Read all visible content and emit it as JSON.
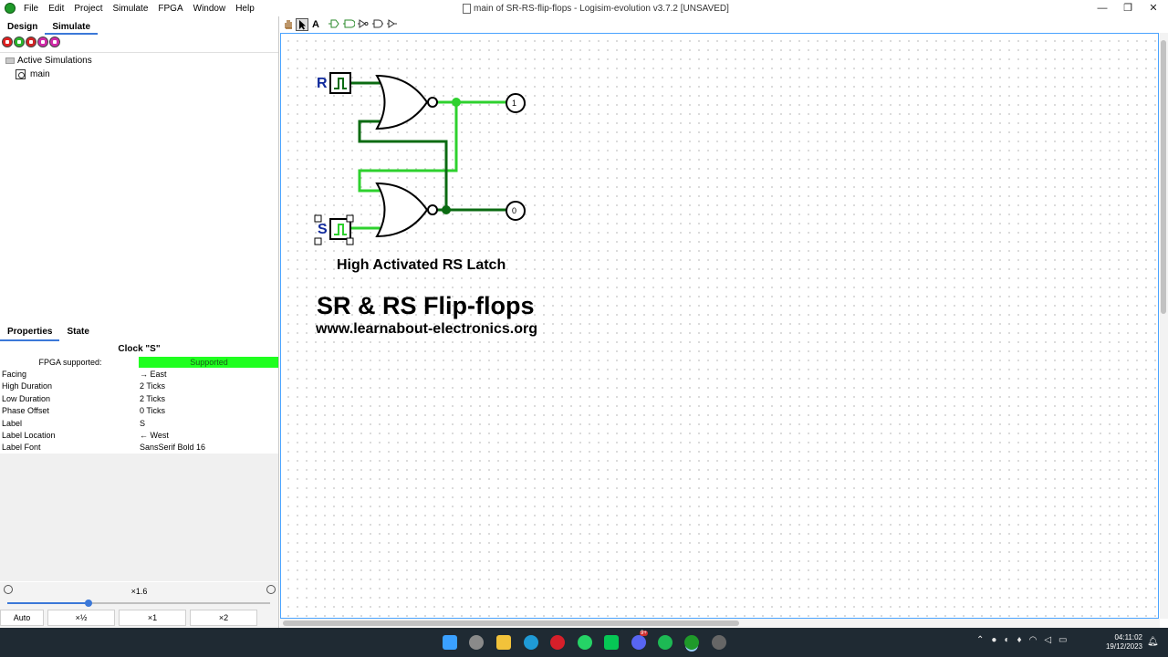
{
  "window": {
    "title": "main of SR-RS-flip-flops - Logisim-evolution v3.7.2 [UNSAVED]",
    "controls": [
      "—",
      "❐",
      "✕"
    ]
  },
  "menu": [
    "File",
    "Edit",
    "Project",
    "Simulate",
    "FPGA",
    "Window",
    "Help"
  ],
  "left_panel": {
    "tabs": [
      "Design",
      "Simulate"
    ],
    "active_tab": "Simulate",
    "sim_toolbar_icons": [
      "stop-icon",
      "step-icon",
      "tick-icon",
      "tick-half-icon",
      "tick-stop-icon"
    ],
    "tree": {
      "root": "Active Simulations",
      "child": "main"
    }
  },
  "properties": {
    "tabs": [
      "Properties",
      "State"
    ],
    "active_tab": "Properties",
    "title": "Clock \"S\"",
    "rows": [
      {
        "key": "FPGA supported:",
        "value": "Supported"
      },
      {
        "key": "Facing",
        "value": "→ East"
      },
      {
        "key": "High Duration",
        "value": "2 Ticks"
      },
      {
        "key": "Low Duration",
        "value": "2 Ticks"
      },
      {
        "key": "Phase Offset",
        "value": "0 Ticks"
      },
      {
        "key": "Label",
        "value": "S"
      },
      {
        "key": "Label Location",
        "value": "← West"
      },
      {
        "key": "Label Font",
        "value": "SansSerif Bold 16"
      }
    ]
  },
  "zoom": {
    "label": "×1.6",
    "level": 0.31,
    "buttons": [
      "Auto",
      "×½",
      "×1",
      "×2"
    ]
  },
  "canvas_toolbar": [
    "hand",
    "select",
    "A",
    "input",
    "output",
    "not",
    "buffer",
    "and"
  ],
  "canvas": {
    "pin_r": "R",
    "pin_s": "S",
    "out_q": "1",
    "out_qbar": "0",
    "caption": "High Activated RS Latch",
    "title": "SR & RS Flip-flops",
    "url": "www.learnabout-electronics.org"
  },
  "colors": {
    "wire_high": "#2ed12e",
    "wire_low": "#0b6b12",
    "accent": "#3b78d8",
    "supported_bg": "#1fff1f",
    "label_blue": "#102a9c"
  },
  "taskbar": {
    "icons": [
      "windows-start-icon",
      "settings-icon",
      "file-explorer-icon",
      "edge-icon",
      "opera-icon",
      "whatsapp-icon",
      "line-icon",
      "discord-icon",
      "spotify-icon",
      "logisim-icon",
      "record-icon"
    ],
    "discord_badge": "9+",
    "time": "04:11:02",
    "date": "19/12/2023"
  }
}
